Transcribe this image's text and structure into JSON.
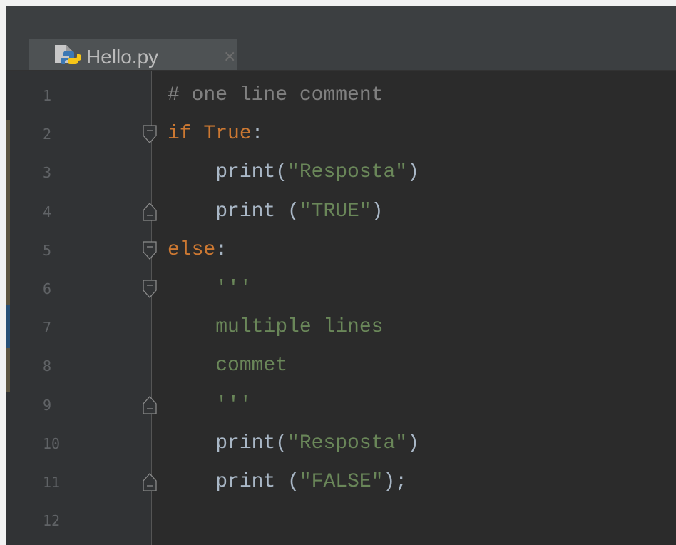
{
  "colors": {
    "tab_underline": "#4a88c7",
    "keyword": "#cc7832",
    "string": "#6a8759",
    "comment": "#808080",
    "default_text": "#a9b7c6",
    "line_number": "#606366"
  },
  "tabs": [
    {
      "label": "Hello.py",
      "icon": "python-file-icon",
      "close_icon": "close-icon",
      "close_glyph": "×",
      "active": true
    }
  ],
  "editor": {
    "line_numbers": [
      "1",
      "2",
      "3",
      "4",
      "5",
      "6",
      "7",
      "8",
      "9",
      "10",
      "11",
      "12"
    ],
    "lines": [
      {
        "segments": [
          {
            "text": "# one line comment",
            "kind": "comment"
          }
        ]
      },
      {
        "segments": [
          {
            "text": "if",
            "kind": "keyword"
          },
          {
            "text": " ",
            "kind": "text"
          },
          {
            "text": "True",
            "kind": "keyword"
          },
          {
            "text": ":",
            "kind": "text"
          }
        ]
      },
      {
        "segments": [
          {
            "text": "    print(",
            "kind": "text"
          },
          {
            "text": "\"Resposta\"",
            "kind": "string"
          },
          {
            "text": ")",
            "kind": "text"
          }
        ]
      },
      {
        "segments": [
          {
            "text": "    print (",
            "kind": "text"
          },
          {
            "text": "\"TRUE\"",
            "kind": "string"
          },
          {
            "text": ")",
            "kind": "text"
          }
        ]
      },
      {
        "segments": [
          {
            "text": "else",
            "kind": "keyword"
          },
          {
            "text": ":",
            "kind": "text"
          }
        ]
      },
      {
        "segments": [
          {
            "text": "    '''",
            "kind": "string"
          }
        ]
      },
      {
        "segments": [
          {
            "text": "    multiple lines",
            "kind": "string"
          }
        ]
      },
      {
        "segments": [
          {
            "text": "    commet",
            "kind": "string"
          }
        ]
      },
      {
        "segments": [
          {
            "text": "    '''",
            "kind": "string"
          }
        ]
      },
      {
        "segments": [
          {
            "text": "    print(",
            "kind": "text"
          },
          {
            "text": "\"Resposta\"",
            "kind": "string"
          },
          {
            "text": ")",
            "kind": "text"
          }
        ]
      },
      {
        "segments": [
          {
            "text": "    print (",
            "kind": "text"
          },
          {
            "text": "\"FALSE\"",
            "kind": "string"
          },
          {
            "text": ");",
            "kind": "text"
          }
        ]
      },
      {
        "segments": [
          {
            "text": "",
            "kind": "text"
          }
        ]
      }
    ],
    "fold_markers": [
      {
        "line": 2,
        "type": "open"
      },
      {
        "line": 4,
        "type": "close"
      },
      {
        "line": 5,
        "type": "open"
      },
      {
        "line": 6,
        "type": "open"
      },
      {
        "line": 9,
        "type": "close"
      },
      {
        "line": 11,
        "type": "close"
      }
    ]
  }
}
